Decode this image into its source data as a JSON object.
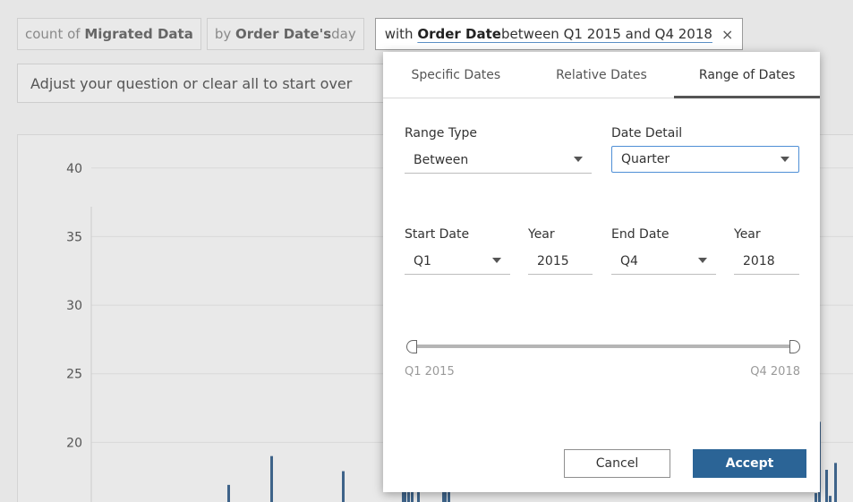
{
  "query": {
    "pill1": {
      "prefix": "count of ",
      "field": "Migrated Data"
    },
    "pill2": {
      "prefix": "by ",
      "field": "Order Date's",
      "suffix": " day"
    },
    "pill3": {
      "prefix": "with ",
      "field": "Order Date",
      "suffix": " between Q1 2015 and Q4 2018",
      "close": "×"
    }
  },
  "hint": "Adjust your question or clear all to start over",
  "popup": {
    "tabs": [
      "Specific Dates",
      "Relative Dates",
      "Range of Dates"
    ],
    "active_tab": "Range of Dates",
    "range_type_label": "Range Type",
    "range_type_value": "Between",
    "date_detail_label": "Date Detail",
    "date_detail_value": "Quarter",
    "start_date_label": "Start Date",
    "start_date_value": "Q1",
    "start_year_label": "Year",
    "start_year_value": "2015",
    "end_date_label": "End Date",
    "end_date_value": "Q4",
    "end_year_label": "Year",
    "end_year_value": "2018",
    "slider_start": "Q1 2015",
    "slider_end": "Q4 2018",
    "cancel": "Cancel",
    "accept": "Accept"
  },
  "colors": {
    "bar": "#3e6389",
    "accept": "#2b6496",
    "focus": "#4f8fd6"
  },
  "chart_data": {
    "type": "bar",
    "yticks": [
      20,
      25,
      30,
      35,
      40
    ],
    "xlim": [
      0,
      830
    ],
    "ylim": [
      15,
      42.4
    ],
    "series_visible_left": [
      {
        "x": 152,
        "value": 16.9
      },
      {
        "x": 200,
        "value": 19.0
      },
      {
        "x": 268,
        "value": 15.2
      },
      {
        "x": 280,
        "value": 17.9
      },
      {
        "x": 347,
        "value": 24.7
      },
      {
        "x": 349,
        "value": 26.9
      },
      {
        "x": 353,
        "value": 18.8
      },
      {
        "x": 357,
        "value": 17.9
      },
      {
        "x": 364,
        "value": 18.9
      },
      {
        "x": 392,
        "value": 19.9
      },
      {
        "x": 394,
        "value": 18.9
      },
      {
        "x": 398,
        "value": 25.9
      }
    ],
    "series_visible_right": [
      {
        "x": 820,
        "value": 18.0
      },
      {
        "x": 824,
        "value": 16.1
      },
      {
        "x": 830,
        "value": 18.5
      },
      {
        "x": 812,
        "value": 21.5
      },
      {
        "x": 808,
        "value": 16.3
      }
    ]
  }
}
